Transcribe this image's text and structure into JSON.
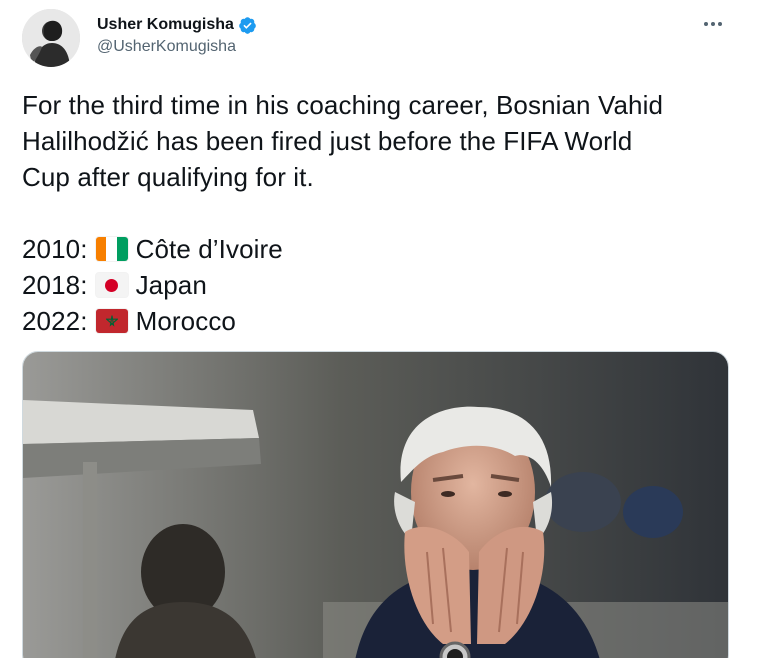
{
  "author": {
    "display_name": "Usher Komugisha",
    "handle": "@UsherKomugisha",
    "verified": true
  },
  "more_button_label": "•••",
  "tweet": {
    "lines": [
      "For the third time in his coaching career, Bosnian Vahid",
      "Halilhodžić has been fired just before the FIFA World",
      "Cup after qualifying for it."
    ],
    "list": [
      {
        "year": "2010:",
        "flag_icon": "cote-divoire-flag-icon",
        "country": "Côte d’Ivoire"
      },
      {
        "year": "2018:",
        "flag_icon": "japan-flag-icon",
        "country": "Japan"
      },
      {
        "year": "2022:",
        "flag_icon": "morocco-flag-icon",
        "country": "Morocco"
      }
    ]
  },
  "colors": {
    "text_primary": "#0f1419",
    "text_secondary": "#536471",
    "verified_blue": "#1d9bf0"
  }
}
